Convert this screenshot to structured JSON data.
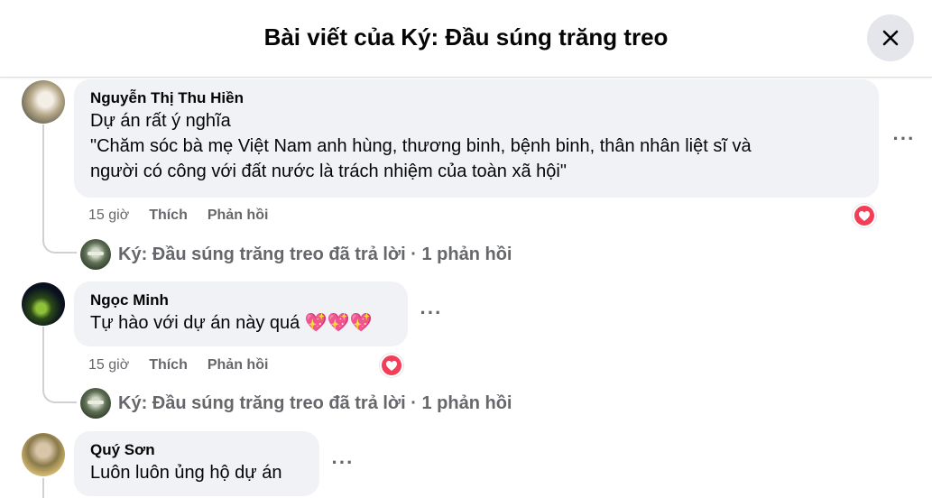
{
  "header": {
    "title": "Bài viết của Ký: Đầu súng trăng treo"
  },
  "comments": [
    {
      "author": "Nguyễn Thị Thu Hiền",
      "lines": [
        "Dự án rất ý nghĩa",
        "\"Chăm sóc bà mẹ Việt Nam anh hùng, thương binh, bệnh binh, thân nhân liệt sĩ và",
        "người có công với đất nước là trách nhiệm của toàn xã hội\""
      ],
      "time": "15 giờ",
      "like": "Thích",
      "reply": "Phản hồi",
      "reply_summary": "Ký: Đầu súng trăng treo đã trả lời · 1 phản hồi",
      "reaction": "heart"
    },
    {
      "author": "Ngọc Minh",
      "lines": [
        "Tự hào với dự án này quá 💖💖💖"
      ],
      "time": "15 giờ",
      "like": "Thích",
      "reply": "Phản hồi",
      "reply_summary": "Ký: Đầu súng trăng treo đã trả lời · 1 phản hồi",
      "reaction": "heart"
    },
    {
      "author": "Quý Sơn",
      "lines": [
        "Luôn luôn ủng hộ dự án"
      ]
    }
  ],
  "icons": {
    "close": "close-icon",
    "more": "more-options-icon",
    "reaction": "heart-reaction-icon"
  },
  "colors": {
    "bubble": "#f0f2f5",
    "muted": "#65676b",
    "love": "#f33e58"
  }
}
